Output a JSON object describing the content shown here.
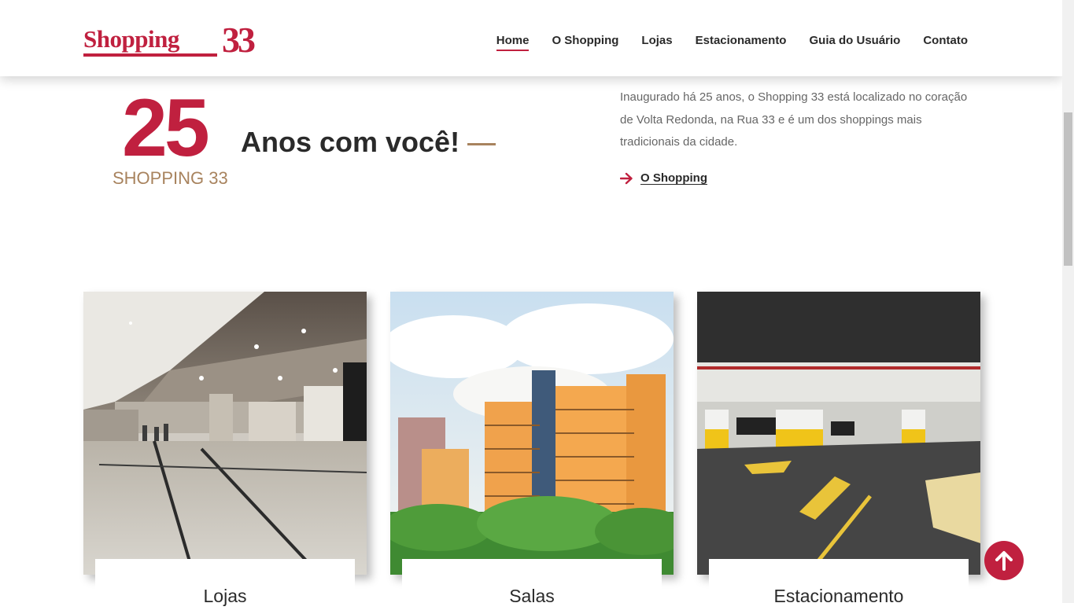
{
  "header": {
    "logo": {
      "word": "Shopping",
      "number": "33"
    },
    "nav": [
      {
        "label": "Home",
        "active": true
      },
      {
        "label": "O Shopping",
        "active": false
      },
      {
        "label": "Lojas",
        "active": false
      },
      {
        "label": "Estacionamento",
        "active": false
      },
      {
        "label": "Guia do Usuário",
        "active": false
      },
      {
        "label": "Contato",
        "active": false
      }
    ]
  },
  "hero": {
    "years": "25",
    "years_caption": "SHOPPING 33",
    "headline": "Anos com você!",
    "intro": "Inaugurado há 25 anos, o Shopping 33 está localizado no coração de Volta Redonda, na Rua 33 e é um dos shoppings mais tradicionais da cidade.",
    "link_label": "O Shopping"
  },
  "cards": [
    {
      "title": "Lojas",
      "image": "mall-interior-photo"
    },
    {
      "title": "Salas",
      "image": "building-towers-photo"
    },
    {
      "title": "Estacionamento",
      "image": "parking-garage-photo"
    }
  ],
  "colors": {
    "brand": "#c0203f",
    "accent": "#a8835e",
    "text": "#2a2a2a",
    "muted": "#666666"
  },
  "icons": {
    "link_arrow": "arrow-right-icon",
    "back_to_top": "arrow-up-icon"
  }
}
